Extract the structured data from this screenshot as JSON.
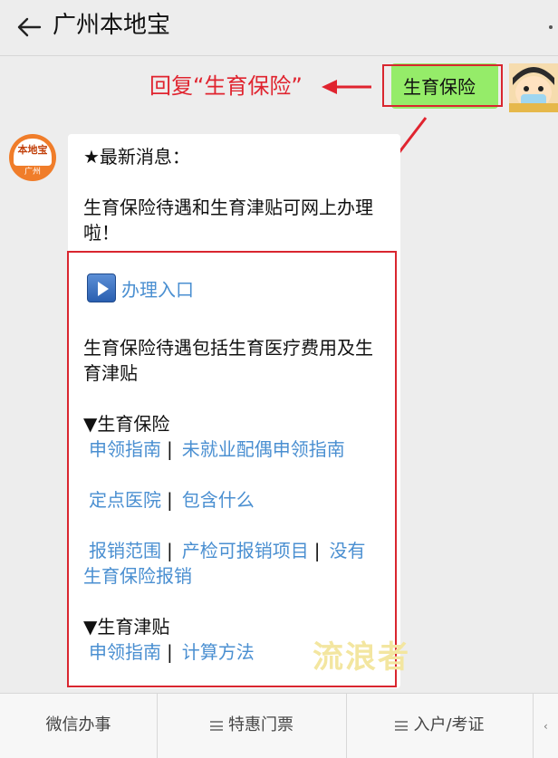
{
  "header": {
    "title": "广州本地宝"
  },
  "annotation": {
    "hint": "回复“生育保险”"
  },
  "user_message": {
    "text": "生育保险"
  },
  "bot": {
    "avatar_logo": "本地宝",
    "avatar_city": "广州"
  },
  "message": {
    "headline": "★最新消息：",
    "intro_line1": "生育保险待遇和生育津贴可网上办理",
    "intro_line2": "啦！",
    "entry_link": "办理入口",
    "summary_line1": "生育保险待遇包括生育医疗费用及生",
    "summary_line2": "育津贴",
    "section_insurance": "▼生育保险",
    "insurance_links": {
      "guide": "申领指南",
      "spouse_guide": "未就业配偶申领指南",
      "hospitals": "定点医院",
      "coverage": "包含什么",
      "scope": "报销范围",
      "prenatal": "产检可报销项目",
      "no_insurance_1": "没有",
      "no_insurance_2": "生育保险报销"
    },
    "section_allowance": "▼生育津贴",
    "allowance_links": {
      "guide": "申领指南",
      "calc": "计算方法"
    },
    "separator": "|"
  },
  "watermark": "流浪者",
  "bottom_menu": {
    "item1": "微信办事",
    "item2": "特惠门票",
    "item3": "入户/考证"
  },
  "colors": {
    "link": "#4a8fd1",
    "annotation": "#e0242f",
    "user_bubble": "#95ec69",
    "avatar_brand": "#f07d2a"
  }
}
